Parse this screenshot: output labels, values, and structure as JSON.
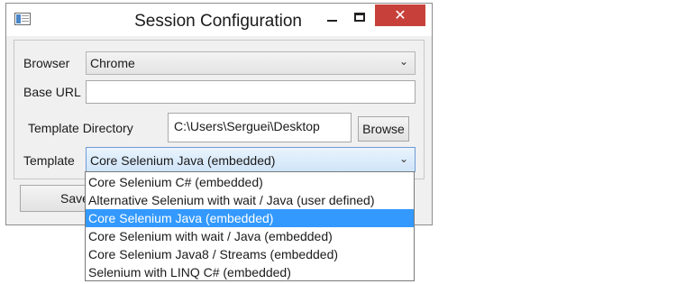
{
  "window": {
    "title": "Session Configuration",
    "close_glyph": "✕"
  },
  "form": {
    "browser_label": "Browser",
    "browser_value": "Chrome",
    "base_url_label": "Base URL",
    "base_url_value": "",
    "template_dir_label": "Template Directory",
    "template_dir_value": "C:\\Users\\Serguei\\Desktop",
    "browse_label": "Browse",
    "template_label": "Template",
    "template_value": "Core Selenium Java (embedded)",
    "save_label": "Save"
  },
  "template_options": [
    "Core Selenium C# (embedded)",
    "Alternative Selenium with wait / Java (user defined)",
    "Core Selenium Java (embedded)",
    "Core Selenium with wait / Java (embedded)",
    "Core Selenium Java8 / Streams (embedded)",
    "Selenium with LINQ C# (embedded)"
  ],
  "selected_option_index": 2,
  "icons": {
    "app": "app-window-icon",
    "minimize": "minimize-icon",
    "maximize": "maximize-icon",
    "close": "close-icon",
    "dropdown": "chevron-down-icon"
  },
  "colors": {
    "close_button": "#c7413a",
    "selection_highlight": "#3399ff"
  }
}
